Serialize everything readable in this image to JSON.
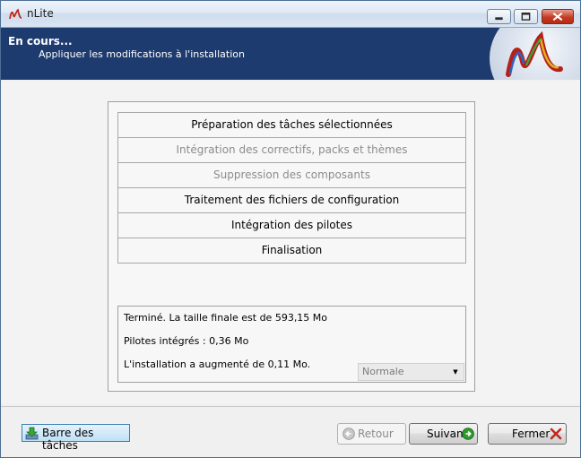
{
  "window": {
    "title": "nLite"
  },
  "header": {
    "title": "En cours...",
    "subtitle": "Appliquer les modifications à l'installation"
  },
  "steps": [
    {
      "label": "Préparation des tâches sélectionnées",
      "state": "active"
    },
    {
      "label": "Intégration des correctifs, packs et thèmes",
      "state": "skipped"
    },
    {
      "label": "Suppression des composants",
      "state": "skipped"
    },
    {
      "label": "Traitement des fichiers de configuration",
      "state": "active"
    },
    {
      "label": "Intégration des pilotes",
      "state": "active"
    },
    {
      "label": "Finalisation",
      "state": "active"
    }
  ],
  "log": {
    "lines": [
      "Terminé. La taille finale est de 593,15 Mo",
      "Pilotes intégrés : 0,36 Mo",
      "L'installation a augmenté de 0,11 Mo."
    ],
    "priority_select": "Normale"
  },
  "footer": {
    "taskbar_label": "Barre des tâches",
    "back_label": "Retour",
    "next_label": "Suivant",
    "close_label": "Fermer"
  },
  "colors": {
    "header_bg": "#1e3b6f",
    "dim_text": "#8c8c8c",
    "next_icon": "#2e9a2e",
    "close_icon": "#c0281c"
  },
  "icons": {
    "app": "nlite-logo-icon",
    "taskbar": "download-arrow-icon",
    "back": "arrow-left-circle-icon",
    "next": "arrow-right-circle-icon",
    "close": "red-x-icon"
  }
}
